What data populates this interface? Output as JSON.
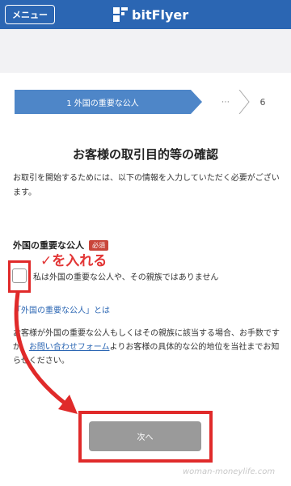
{
  "header": {
    "menu_label": "メニュー",
    "brand": "bitFlyer",
    "bg_color": "#2b66b3"
  },
  "steps": {
    "current": "1 外国の重要な公人",
    "middle": "⋯",
    "last": "6"
  },
  "page": {
    "title": "お客様の取引目的等の確認",
    "intro": "お取引を開始するためには、以下の情報を入力していただく必要がございます。"
  },
  "section": {
    "label": "外国の重要な公人",
    "required_badge": "必須",
    "checkbox_label": "私は外国の重要な公人や、その親族ではありません",
    "checkbox_checked": false,
    "info_link": "「外国の重要な公人」とは"
  },
  "notice": {
    "text_before": "お客様が外国の重要な公人もしくはその親族に該当する場合、お手数ですが、",
    "link_text": "お問い合わせフォーム",
    "text_after": "よりお客様の具体的な公的地位を当社までお知らせください。"
  },
  "next_button": {
    "label": "次へ",
    "disabled": true
  },
  "annotation": {
    "text": "✓を入れる",
    "color": "#e02a2a"
  },
  "watermark": "woman-moneylife.com"
}
